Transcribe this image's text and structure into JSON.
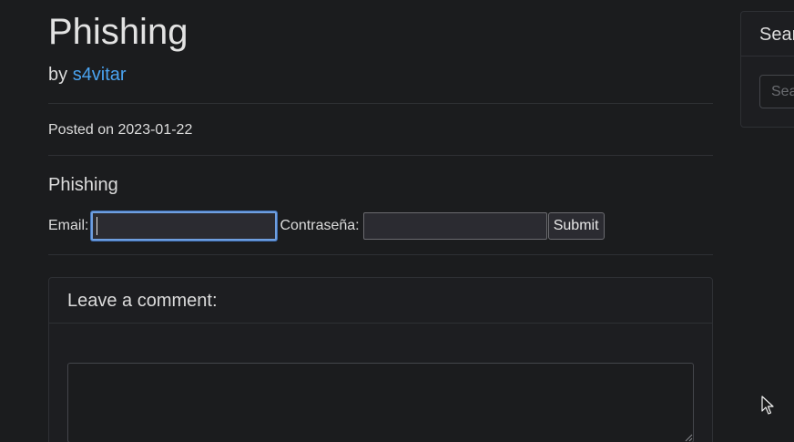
{
  "post": {
    "title": "Phishing",
    "by_prefix": "by",
    "author": "s4vitar",
    "posted": "Posted on 2023-01-22",
    "section_heading": "Phishing"
  },
  "form": {
    "email_label": "Email:",
    "email_value": "",
    "password_label": "Contraseña:",
    "password_value": "",
    "submit_label": "Submit"
  },
  "comment": {
    "header": "Leave a comment:",
    "value": ""
  },
  "sidebar": {
    "search_header": "Search",
    "search_placeholder": "Search"
  },
  "icons": {
    "cursor": "mouse-pointer-icon",
    "resize": "resize-grip-icon"
  },
  "colors": {
    "background": "#1b1c1e",
    "link": "#4aa3f0",
    "focus_ring": "#6f9fe0"
  }
}
